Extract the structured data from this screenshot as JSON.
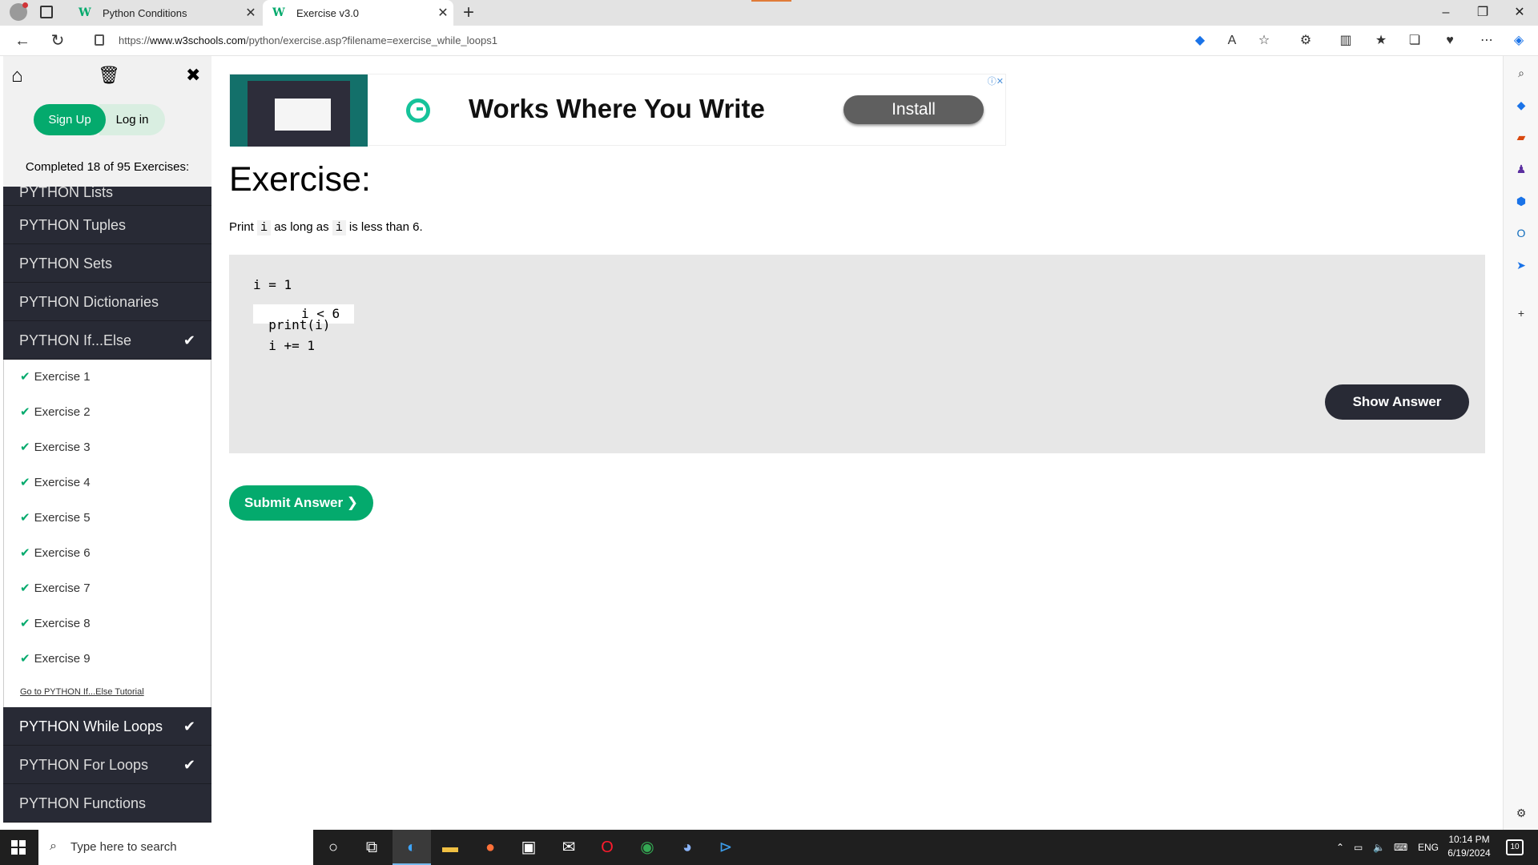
{
  "browser": {
    "tabs": [
      {
        "label": "Python Conditions",
        "icon": "w3schools-icon"
      },
      {
        "label": "Exercise v3.0",
        "icon": "w3schools-icon"
      }
    ],
    "url_prefix": "https://",
    "url_domain": "www.w3schools.com",
    "url_path": "/python/exercise.asp?filename=exercise_while_loops1"
  },
  "sidebar": {
    "signup_label": "Sign Up",
    "login_label": "Log in",
    "completed_text": "Completed 18 of 95 Exercises:",
    "categories_top": [
      {
        "label": "PYTHON Lists",
        "checked": false
      },
      {
        "label": "PYTHON Tuples",
        "checked": false
      },
      {
        "label": "PYTHON Sets",
        "checked": false
      },
      {
        "label": "PYTHON Dictionaries",
        "checked": false
      },
      {
        "label": "PYTHON If...Else",
        "checked": true
      }
    ],
    "exercises": [
      "Exercise 1",
      "Exercise 2",
      "Exercise 3",
      "Exercise 4",
      "Exercise 5",
      "Exercise 6",
      "Exercise 7",
      "Exercise 8",
      "Exercise 9"
    ],
    "tutorial_link": "Go to PYTHON If...Else Tutorial",
    "categories_bottom": [
      {
        "label": "PYTHON While Loops",
        "checked": true
      },
      {
        "label": "PYTHON For Loops",
        "checked": true
      },
      {
        "label": "PYTHON Functions",
        "checked": false
      }
    ]
  },
  "ad": {
    "title": "Works Where You Write",
    "install_label": "Install"
  },
  "exercise": {
    "heading": "Exercise:",
    "desc_part1": "Print ",
    "desc_code1": "i",
    "desc_part2": " as long as ",
    "desc_code2": "i",
    "desc_part3": " is less than 6.",
    "code_line1": "i = 1",
    "code_cond": "i < 6",
    "code_line3": "  print(i)",
    "code_line4": "  i += 1",
    "show_answer_label": "Show Answer",
    "submit_label": "Submit Answer ❯"
  },
  "taskbar": {
    "search_placeholder": "Type here to search",
    "language": "ENG",
    "time": "10:14 PM",
    "date": "6/19/2024",
    "notification_count": "10"
  },
  "colors": {
    "w3_green": "#04aa6d",
    "sidebar_dark": "#282a35",
    "code_bg": "#e7e7e7"
  }
}
